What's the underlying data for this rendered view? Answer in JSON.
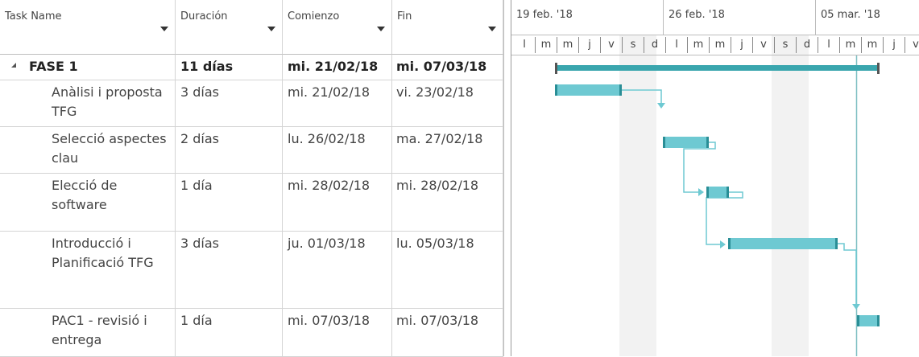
{
  "columns": {
    "task": "Task Name",
    "duration": "Duración",
    "start": "Comienzo",
    "finish": "Fin"
  },
  "rows": [
    {
      "name": "FASE 1",
      "duration": "11 días",
      "start": "mi. 21/02/18",
      "finish": "mi. 07/03/18",
      "summary": true
    },
    {
      "name": "Anàlisi i proposta TFG",
      "duration": "3 días",
      "start": "mi. 21/02/18",
      "finish": "vi. 23/02/18"
    },
    {
      "name": "Selecció aspectes clau",
      "duration": "2 días",
      "start": "lu. 26/02/18",
      "finish": "ma. 27/02/18"
    },
    {
      "name": "Elecció de software",
      "duration": "1 día",
      "start": "mi. 28/02/18",
      "finish": "mi. 28/02/18"
    },
    {
      "name": "Introducció i Planificació TFG",
      "duration": "3 días",
      "start": "ju. 01/03/18",
      "finish": "lu. 05/03/18"
    },
    {
      "name": "PAC1 - revisió i entrega",
      "duration": "1 día",
      "start": "mi. 07/03/18",
      "finish": "mi. 07/03/18"
    }
  ],
  "timescale": {
    "weeks": [
      "19 feb. '18",
      "26 feb. '18",
      "05 mar. '18"
    ],
    "days": [
      "l",
      "m",
      "m",
      "j",
      "v",
      "s",
      "d",
      "l",
      "m",
      "m",
      "j",
      "v",
      "s",
      "d",
      "l",
      "m",
      "m",
      "j",
      "v"
    ]
  },
  "colors": {
    "bar": "#6ec9d2",
    "summary": "#3aa6ae",
    "link": "#6ec9d2",
    "weekend": "#f2f2f2"
  }
}
